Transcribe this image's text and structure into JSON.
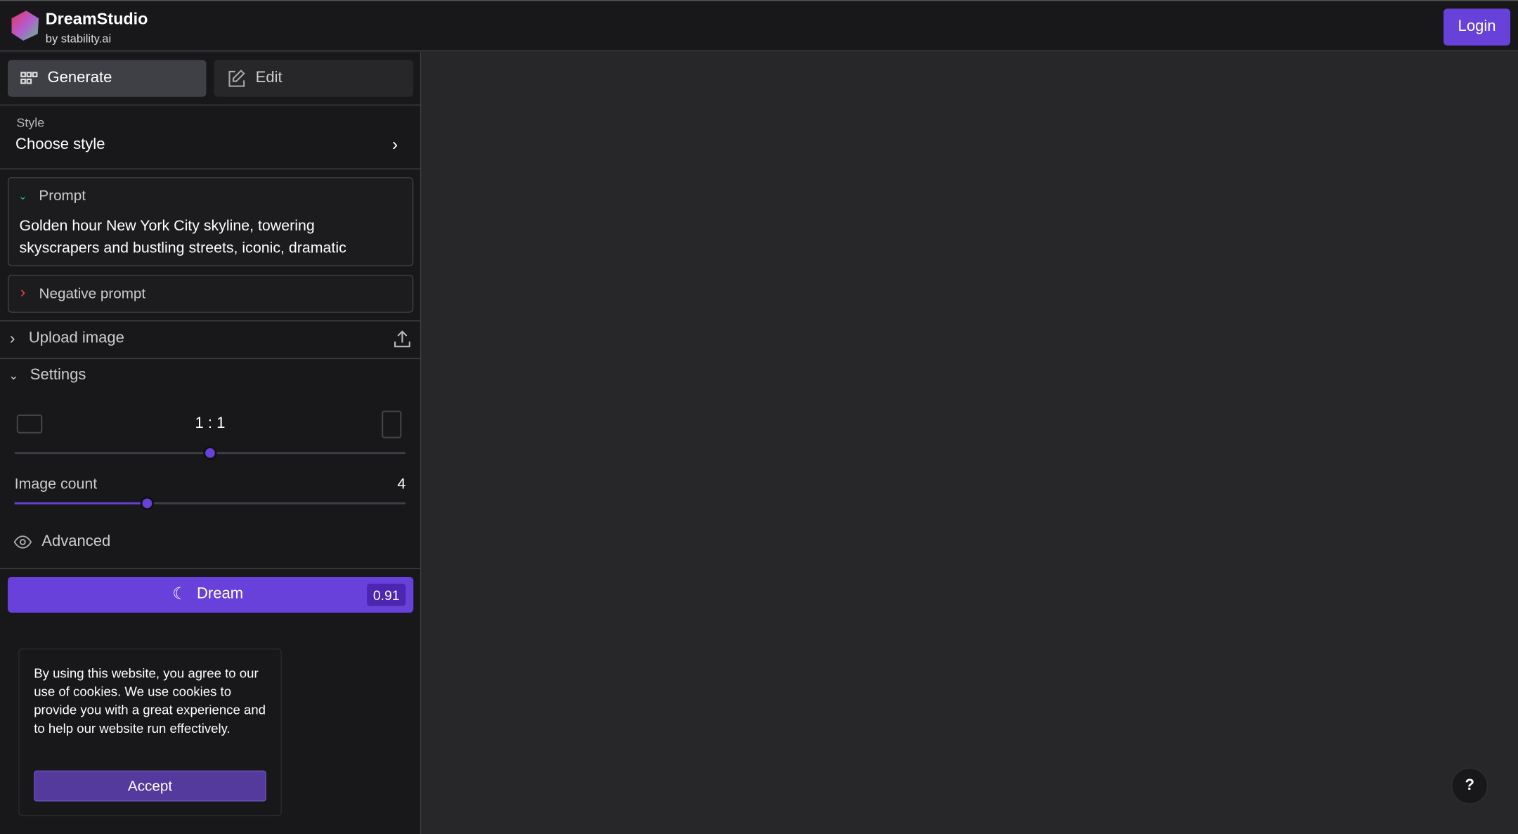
{
  "header": {
    "app_name": "DreamStudio",
    "byline": "by stability.ai",
    "login_label": "Login"
  },
  "tabs": [
    {
      "label": "Generate",
      "icon": "grid-icon",
      "active": true
    },
    {
      "label": "Edit",
      "icon": "edit-icon",
      "active": false
    }
  ],
  "style": {
    "label": "Style",
    "value": "Choose style"
  },
  "prompt": {
    "label": "Prompt",
    "text": "Golden hour New York City skyline, towering skyscrapers and bustling streets, iconic, dramatic"
  },
  "negative_prompt": {
    "label": "Negative prompt"
  },
  "upload": {
    "label": "Upload image"
  },
  "settings": {
    "label": "Settings",
    "aspect_ratio": "1 : 1",
    "aspect_slider_fraction": 0.5,
    "image_count_label": "Image count",
    "image_count": "4",
    "image_count_fraction": 0.34,
    "advanced_label": "Advanced"
  },
  "dream": {
    "label": "Dream",
    "cost": "0.91"
  },
  "cookie": {
    "text": "By using this website, you agree to our use of cookies. We use cookies to provide you with a great experience and to help our website run effectively.",
    "accept_label": "Accept"
  },
  "help": {
    "label": "?"
  },
  "colors": {
    "accent": "#6741d9",
    "sidebar_bg": "#18181b",
    "main_bg": "#27272a"
  }
}
